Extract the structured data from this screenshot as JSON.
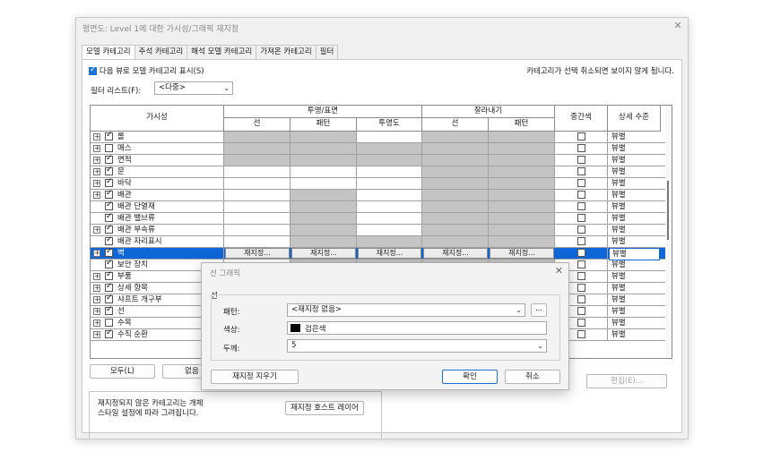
{
  "window": {
    "title": "평면도: Level 1에 대한 가시성/그래픽 재지정",
    "close_label": "✕"
  },
  "tabs": [
    "모델 카테고리",
    "주석 카테고리",
    "해석 모델 카테고리",
    "가져온 카테고리",
    "필터"
  ],
  "show_checkbox_label": "다음 뷰로 모델 카테고리 표시(S)",
  "note": "카테고리가 선택 취소되면 보이지 않게 됩니다.",
  "filter_list": {
    "label": "필터 리스트(F):",
    "value": "<다중>"
  },
  "table": {
    "headers": {
      "visibility": "가시성",
      "projection": "투영/표면",
      "line": "선",
      "pattern": "패턴",
      "transparency": "투명도",
      "cut": "잘라내기",
      "cut_line": "선",
      "cut_pattern": "패턴",
      "halftone": "중간색",
      "detail": "상세 수준"
    },
    "override_label": "재지정...",
    "rows": [
      {
        "name": "롤",
        "checked": true,
        "expand": true,
        "detail": "뷰별"
      },
      {
        "name": "매스",
        "checked": false,
        "expand": true,
        "detail": "뷰별"
      },
      {
        "name": "면적",
        "checked": true,
        "expand": true,
        "detail": "뷰별"
      },
      {
        "name": "문",
        "checked": true,
        "expand": true,
        "detail": "뷰별"
      },
      {
        "name": "바닥",
        "checked": true,
        "expand": true,
        "detail": "뷰별"
      },
      {
        "name": "배관",
        "checked": true,
        "expand": true,
        "detail": "뷰별"
      },
      {
        "name": "배관 단열재",
        "checked": true,
        "expand": false,
        "detail": "뷰별"
      },
      {
        "name": "배관 밸브류",
        "checked": true,
        "expand": false,
        "detail": "뷰별"
      },
      {
        "name": "배관 부속류",
        "checked": true,
        "expand": true,
        "detail": "뷰별"
      },
      {
        "name": "배관 자리표시",
        "checked": true,
        "expand": false,
        "detail": "뷰별"
      },
      {
        "name": "벽",
        "checked": true,
        "expand": true,
        "detail": "뷰별",
        "selected": true
      },
      {
        "name": "보안 장치",
        "checked": true,
        "expand": false,
        "detail": "뷰별"
      },
      {
        "name": "부품",
        "checked": true,
        "expand": true,
        "detail": "뷰별"
      },
      {
        "name": "상세 항목",
        "checked": true,
        "expand": true,
        "detail": "뷰별"
      },
      {
        "name": "샤프트 개구부",
        "checked": true,
        "expand": true,
        "detail": "뷰별"
      },
      {
        "name": "선",
        "checked": true,
        "expand": true,
        "detail": "뷰별"
      },
      {
        "name": "수목",
        "checked": false,
        "expand": true,
        "detail": "뷰별"
      },
      {
        "name": "수직 순환",
        "checked": true,
        "expand": true,
        "detail": "뷰별"
      }
    ]
  },
  "buttons": {
    "all": "모두(L)",
    "none": "없음",
    "edit": "편집(E)...",
    "override_partial": "재지정 호스트 레이어"
  },
  "info_text": "재지정되지 않은 카테고리는 개체 스타일 설정에 따라 그려집니다.",
  "dialog": {
    "title": "선 그래픽",
    "close_label": "✕",
    "group": "선",
    "pattern_label": "패턴:",
    "pattern_value": "<재지정 없음>",
    "more_label": "...",
    "color_label": "색상:",
    "color_value": "검은색",
    "color_swatch": "#000000",
    "weight_label": "두께:",
    "weight_value": "5",
    "clear_label": "재지정 지우기",
    "ok_label": "확인",
    "cancel_label": "취소"
  }
}
